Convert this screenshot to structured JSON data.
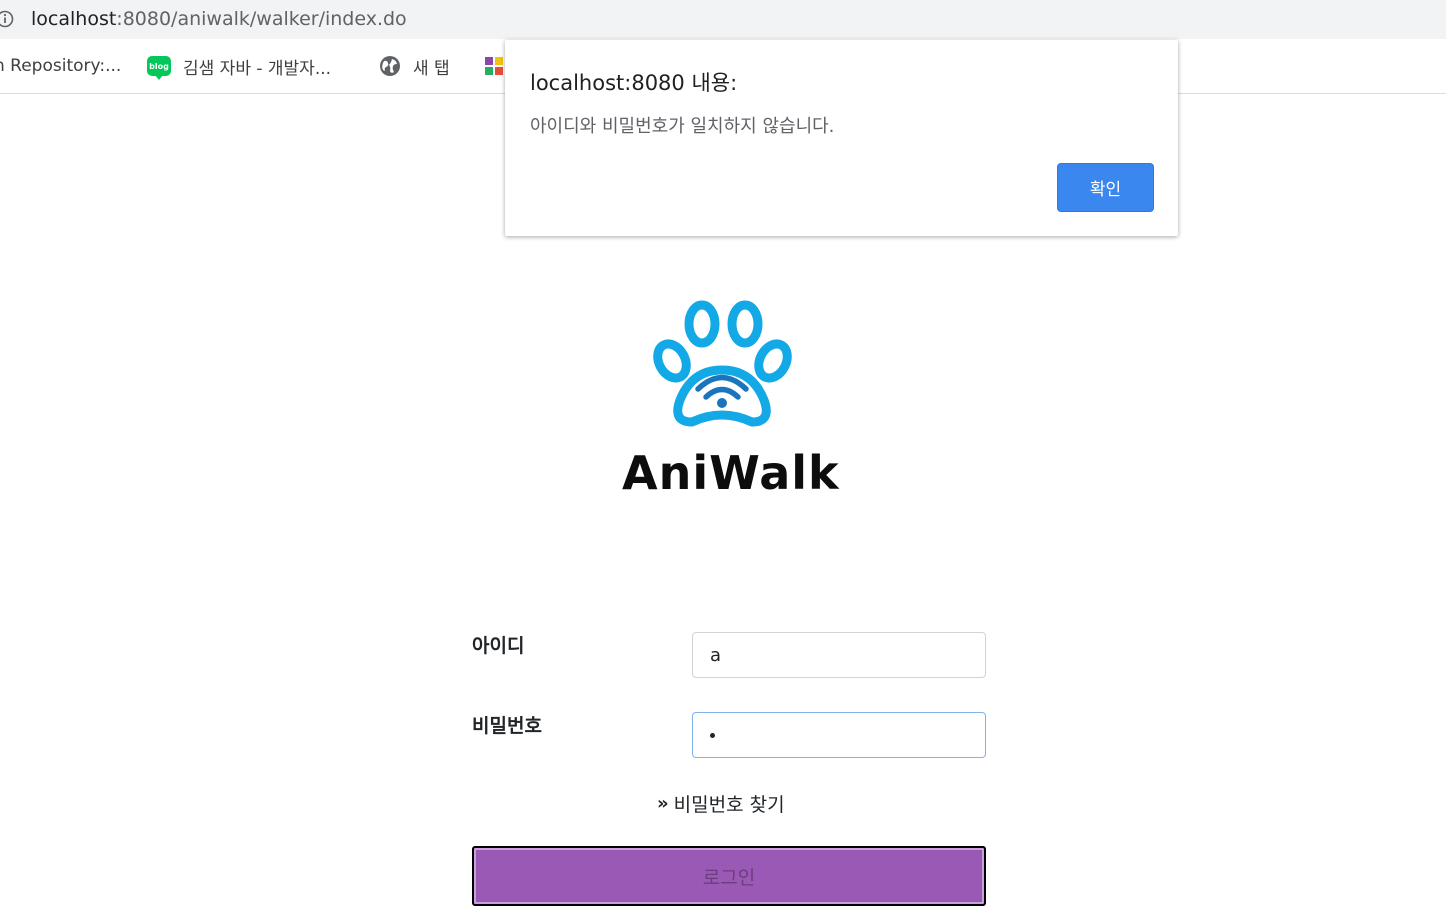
{
  "browser": {
    "url_host": "localhost",
    "url_rest": ":8080/aniwalk/walker/index.do",
    "bookmarks": [
      {
        "label": "n Repository:...",
        "icon": "none"
      },
      {
        "label": "김샘 자바 - 개발자...",
        "icon": "blog-icon"
      },
      {
        "label": "새 탭",
        "icon": "globe-icon"
      },
      {
        "label": "",
        "icon": "puzzle-icon"
      }
    ]
  },
  "dialog": {
    "title": "localhost:8080 내용:",
    "message": "아이디와 비밀번호가 일치하지 않습니다.",
    "ok_label": "확인",
    "ok_color": "#3b87f0"
  },
  "logo": {
    "text": "AniWalk",
    "paw_color": "#12a9e6"
  },
  "form": {
    "id_label": "아이디",
    "id_value": "a",
    "pw_label": "비밀번호",
    "pw_masked_count": 1,
    "find_pw_label": "비밀번호 찾기",
    "login_label": "로그인",
    "login_color": "#9b59b6"
  }
}
